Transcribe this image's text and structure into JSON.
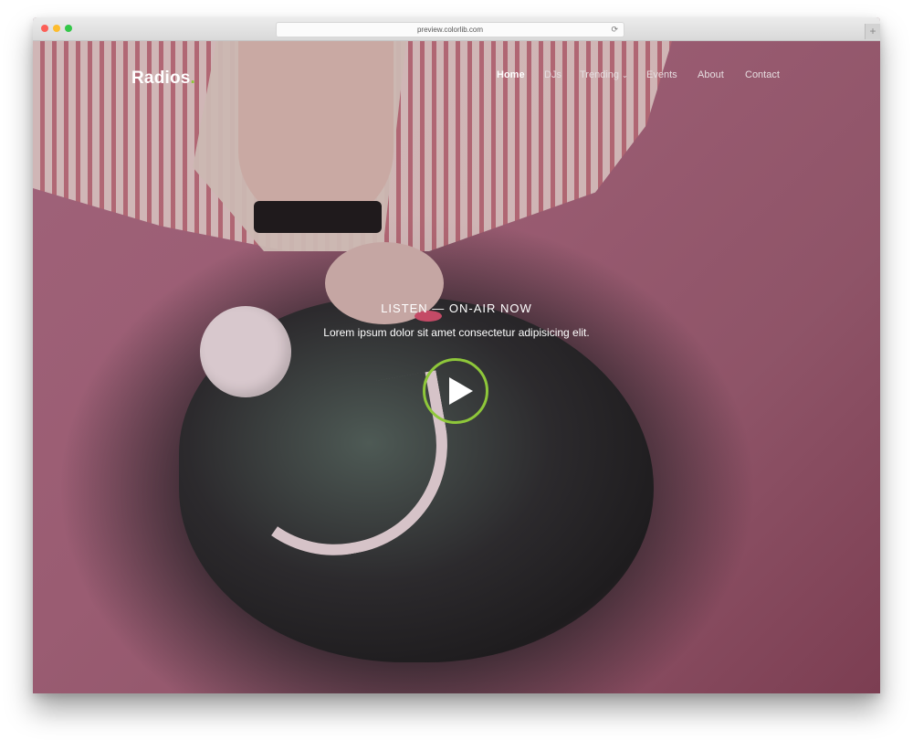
{
  "browser": {
    "url": "preview.colorlib.com",
    "reload_icon": "⟳",
    "new_tab_icon": "+"
  },
  "site": {
    "logo": "Radios",
    "logo_dot": ".",
    "accent_color": "#8ec73a",
    "nav": [
      {
        "label": "Home",
        "active": true
      },
      {
        "label": "DJs"
      },
      {
        "label": "Trending",
        "dropdown_icon": "⌄"
      },
      {
        "label": "Events"
      },
      {
        "label": "About"
      },
      {
        "label": "Contact"
      }
    ]
  },
  "hero": {
    "title": "LISTEN — ON-AIR NOW",
    "subtitle": "Lorem ipsum dolor sit amet consectetur adipisicing elit.",
    "play_icon": "play-icon"
  }
}
